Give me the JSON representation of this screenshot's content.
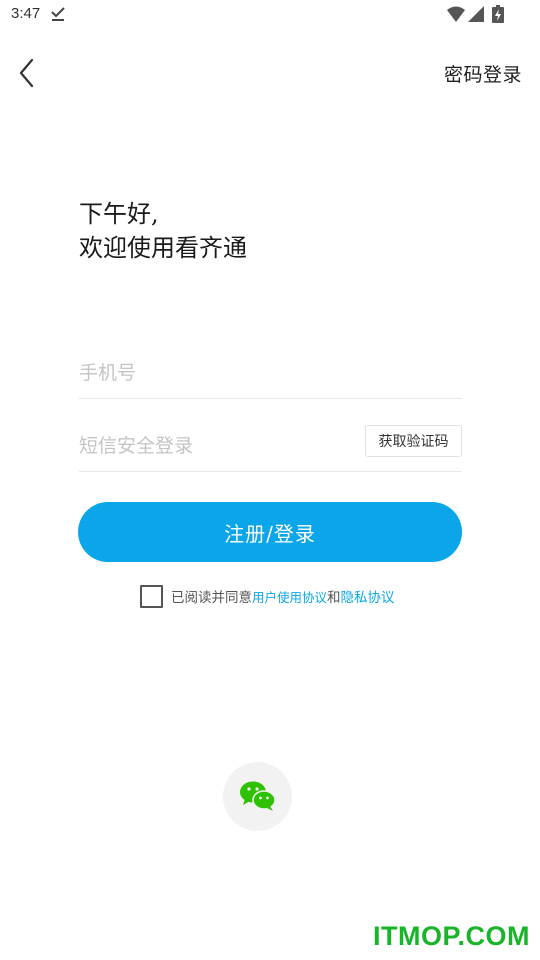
{
  "status_bar": {
    "time": "3:47",
    "icons": [
      "download-done-icon",
      "wifi-icon",
      "cell-signal-icon",
      "battery-charging-icon"
    ]
  },
  "header": {
    "back_icon": "chevron-left-icon",
    "password_login_label": "密码登录"
  },
  "greeting": {
    "line1": "下午好,",
    "line2": "欢迎使用看齐通"
  },
  "form": {
    "phone_placeholder": "手机号",
    "phone_value": "",
    "sms_placeholder": "短信安全登录",
    "sms_value": "",
    "get_code_label": "获取验证码",
    "submit_label": "注册/登录"
  },
  "agreement": {
    "checked": false,
    "prefix": "已阅读并同意",
    "user_agreement": "用户使用协议",
    "conjunction": "和",
    "privacy_agreement": "隐私协议"
  },
  "third_party": {
    "wechat_icon": "wechat-icon"
  },
  "watermark": "ITMOP.COM",
  "colors": {
    "accent": "#0aa6e9",
    "watermark": "#18b52a",
    "wechat": "#2dc100"
  }
}
